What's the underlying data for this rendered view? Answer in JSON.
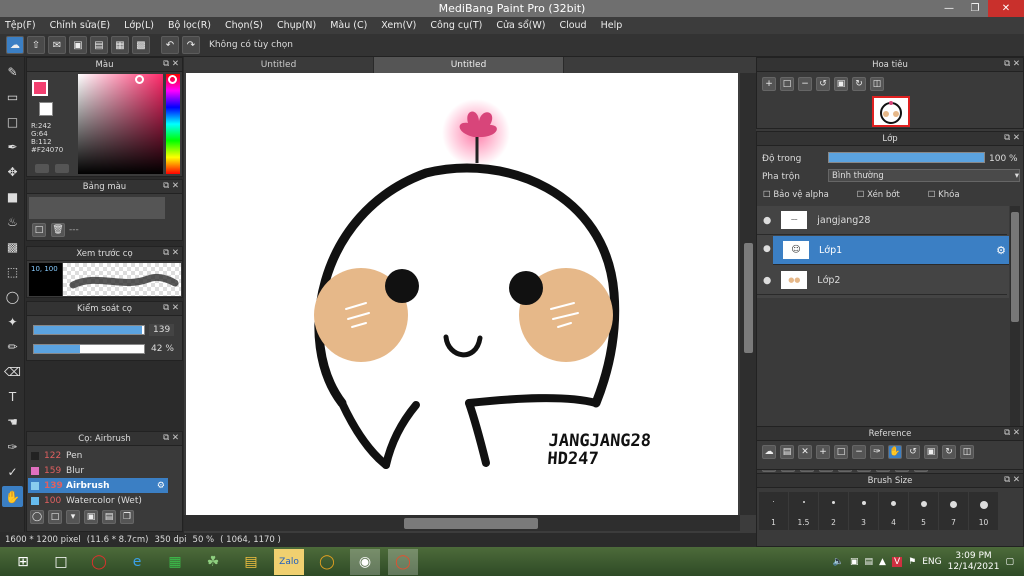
{
  "window": {
    "title": "MediBang Paint Pro (32bit)"
  },
  "menu": [
    "Tệp(F)",
    "Chỉnh sửa(E)",
    "Lớp(L)",
    "Bộ lọc(R)",
    "Chọn(S)",
    "Chụp(N)",
    "Màu (C)",
    "Xem(V)",
    "Công cụ(T)",
    "Cửa sổ(W)",
    "Cloud",
    "Help"
  ],
  "toolbar": {
    "hint": "Không có tùy chọn"
  },
  "color_panel": {
    "title": "Màu",
    "r": "R:242",
    "g": "G:64",
    "b": "B:112",
    "hex": "#F24070",
    "fg_color": "#f24070"
  },
  "palette_panel": {
    "title": "Bảng màu",
    "placeholder": "---"
  },
  "brush_preview": {
    "title": "Xem trước cọ",
    "size_label": "10, 100"
  },
  "brush_control": {
    "title": "Kiểm soát cọ",
    "size_value": "139",
    "opacity_value": "42 %",
    "size_fraction": 0.98,
    "opacity_fraction": 0.42
  },
  "brush_list": {
    "title": "Cọ: Airbrush",
    "items": [
      {
        "size": "122",
        "name": "Pen",
        "color": "#222222"
      },
      {
        "size": "159",
        "name": "Blur",
        "color": "#e070c0"
      },
      {
        "size": "139",
        "name": "Airbrush",
        "color": "#88ccee"
      },
      {
        "size": "100",
        "name": "Watercolor (Wet)",
        "color": "#66bbee"
      }
    ],
    "selected_index": 2
  },
  "tabs": [
    "Untitled",
    "Untitled"
  ],
  "canvas": {
    "text_line1": "JANGJANG28",
    "text_line2": "HD247"
  },
  "status": {
    "dims": "1600 * 1200 pixel",
    "size": "(11.6 * 8.7cm)",
    "dpi": "350 dpi",
    "zoom": "50 %",
    "coords": "( 1064, 1170 )"
  },
  "navigator": {
    "title": "Hoa tiêu"
  },
  "layers_panel": {
    "title": "Lớp",
    "opacity_label": "Độ trong",
    "opacity_value": "100 %",
    "opacity_fraction": 1.0,
    "blend_label": "Pha trộn",
    "blend_value": "Bình thường",
    "protect_alpha": "Bảo vệ alpha",
    "clipping": "Xén bớt",
    "lock": "Khóa",
    "layers": [
      {
        "name": "jangjang28"
      },
      {
        "name": "Lớp1"
      },
      {
        "name": "Lớp2"
      }
    ]
  },
  "reference_panel": {
    "title": "Reference"
  },
  "brush_size_panel": {
    "title": "Brush Size",
    "sizes": [
      "1",
      "1.5",
      "2",
      "3",
      "4",
      "5",
      "7",
      "10"
    ]
  },
  "taskbar": {
    "lang": "ENG",
    "time": "3:09 PM",
    "date": "12/14/2021"
  }
}
